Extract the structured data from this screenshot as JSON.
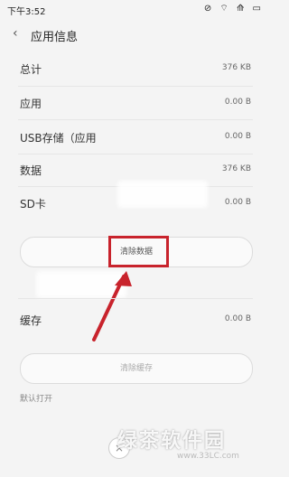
{
  "status_bar": {
    "time": "下午3:52",
    "icons": "⊘ ⌔ ⟰ ▭"
  },
  "header": {
    "back_icon": "‹",
    "title": "应用信息"
  },
  "rows": [
    {
      "label": "总计",
      "value": "376 KB"
    },
    {
      "label": "应用",
      "value": "0.00 B"
    },
    {
      "label": "USB存储（应用",
      "value": "0.00 B"
    },
    {
      "label": "数据",
      "value": "376 KB"
    },
    {
      "label": "SD卡",
      "value": "0.00 B"
    }
  ],
  "buttons": {
    "clear_data": "清除数据",
    "clear_cache": "清除缓存"
  },
  "cache": {
    "label": "缓存",
    "value": "0.00 B"
  },
  "sections": {
    "default_open": "默认打开"
  },
  "watermark": {
    "text": "绿茶软件园",
    "url": "www.33LC.com"
  },
  "annotation": {
    "highlight_color": "#c8232c",
    "arrow_color": "#c8232c"
  }
}
